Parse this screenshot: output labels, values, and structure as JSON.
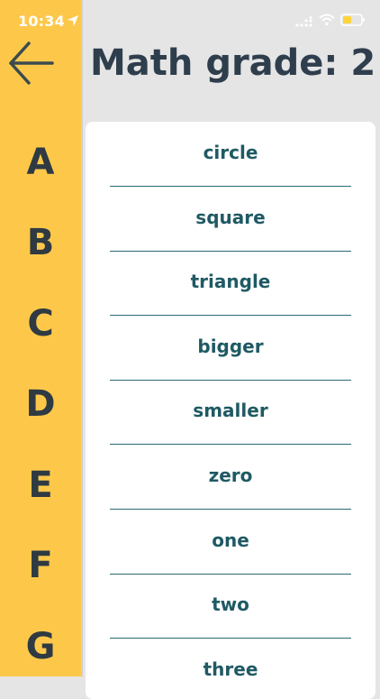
{
  "status_bar": {
    "time": "10:34"
  },
  "header": {
    "title": "Math grade: 2"
  },
  "letters": [
    "A",
    "B",
    "C",
    "D",
    "E",
    "F",
    "G"
  ],
  "words": [
    "circle",
    "square",
    "triangle",
    "bigger",
    "smaller",
    "zero",
    "one",
    "two",
    "three"
  ],
  "colors": {
    "sidebar": "#fdc84a",
    "background": "#e5e5e5",
    "word_text": "#1f5a64",
    "divider": "#2b6a74",
    "title": "#2f3e4d"
  }
}
